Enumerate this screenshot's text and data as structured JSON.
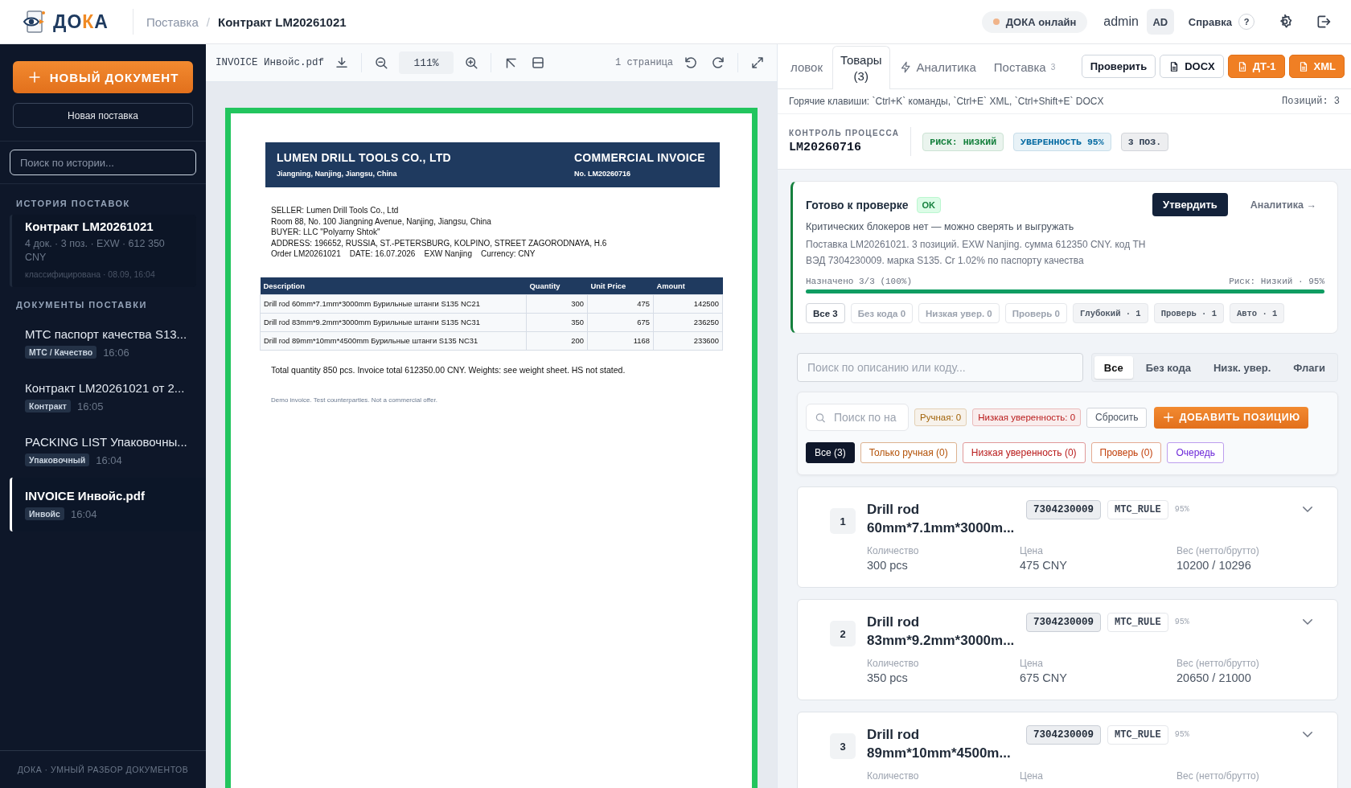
{
  "header": {
    "logo": [
      {
        "text": "ДО",
        "accent": false
      },
      {
        "text": "К",
        "accent": true
      },
      {
        "text": "А",
        "accent": false
      }
    ],
    "breadcrumb": {
      "items": [
        "Поставка",
        "Контракт LM20261021"
      ],
      "separator": "/"
    },
    "status": "ДОКА онлайн",
    "user": "admin",
    "avatar": "AD",
    "help": "Справка",
    "help_mark": "?"
  },
  "sidebar": {
    "new_button": "НОВЫЙ ДОКУМЕНТ",
    "new_shipment": "Новая поставка",
    "search_placeholder": "Поиск по истории...",
    "history_title": "ИСТОРИЯ ПОСТАВОК",
    "history": [
      {
        "title": "Контракт LM20261021",
        "meta": "4 док. · 3 поз. · EXW · 612 350 CNY",
        "status": "классифицирована · 08.09, 16:04",
        "selected": true
      }
    ],
    "documents_title": "ДОКУМЕНТЫ ПОСТАВКИ",
    "documents": [
      {
        "name": "MTC паспорт качества S13...",
        "tag": "MTC / Качество",
        "time": "16:06",
        "selected": false
      },
      {
        "name": "Контракт LM20261021 от 2...",
        "tag": "Контракт",
        "time": "16:05",
        "selected": false
      },
      {
        "name": "PACKING LIST Упаковочны...",
        "tag": "Упаковочный",
        "time": "16:04",
        "selected": false
      },
      {
        "name": "INVOICE Инвойс.pdf",
        "tag": "Инвойс",
        "time": "16:04",
        "selected": true
      }
    ],
    "footer": "ДОКА · УМНЫЙ РАЗБОР ДОКУМЕНТОВ"
  },
  "viewer": {
    "filename": "INVOICE Инвойс.pdf",
    "zoom": "111%",
    "pages": "1 страница",
    "document": {
      "company": "LUMEN DRILL TOOLS CO., LTD",
      "company_address": "Jiangning, Nanjing, Jiangsu, China",
      "title": "COMMERCIAL INVOICE",
      "number": "No. LM20260716",
      "lines": [
        "SELLER: Lumen Drill Tools Co., Ltd",
        "Room 88, No. 100 Jiangning Avenue, Nanjing, Jiangsu, China",
        "BUYER: LLC \"Polyarny Shtok\"",
        "ADDRESS: 196652, RUSSIA, ST.-PETERSBURG, KOLPINO, STREET ZAGORODNAYA, H.6",
        "Order LM20261021    DATE: 16.07.2026    EXW Nanjing    Currency: CNY"
      ],
      "columns": [
        "Description",
        "Quantity",
        "Unit Price",
        "Amount"
      ],
      "rows": [
        [
          "Drill rod 60mm*7.1mm*3000mm Бурильные штанги S135 NC21",
          "300",
          "475",
          "142500"
        ],
        [
          "Drill rod 83mm*9.2mm*3000mm Бурильные штанги S135 NC31",
          "350",
          "675",
          "236250"
        ],
        [
          "Drill rod 89mm*10mm*4500mm Бурильные штанги S135 NC31",
          "200",
          "1168",
          "233600"
        ]
      ],
      "total": "Total quantity 850 pcs. Invoice total 612350.00 CNY. Weights: see weight sheet. HS not stated.",
      "note": "Demo invoice. Test counterparties. Not a commercial offer."
    }
  },
  "panel": {
    "tabs": [
      {
        "label": "ловок",
        "kind": "plain",
        "selected": false
      },
      {
        "label": "Товары (3)",
        "kind": "plain",
        "selected": true
      },
      {
        "label": "Аналитика",
        "kind": "bolt",
        "selected": false
      },
      {
        "label": "Поставка",
        "kind": "count",
        "count": "3",
        "selected": false
      }
    ],
    "actions": [
      {
        "label": "Проверить",
        "kind": "outline"
      },
      {
        "label": "DOCX",
        "kind": "outline-doc"
      },
      {
        "label": "ДТ-1",
        "kind": "accent-report"
      },
      {
        "label": "XML",
        "kind": "accent-doc"
      }
    ],
    "hotkeys": "Горячие клавиши: `Ctrl+K` команды, `Ctrl+E` XML, `Ctrl+Shift+E` DOCX",
    "positions": "Позиций: 3",
    "process": {
      "label": "КОНТРОЛЬ ПРОЦЕССА",
      "id": "LM20260716",
      "badges": [
        {
          "text": "РИСК: НИЗКИЙ",
          "color": "#15803d"
        },
        {
          "text": "УВЕРЕННОСТЬ 95%",
          "color": "#0369a1"
        },
        {
          "text": "3 ПОЗ.",
          "color": "#334155"
        }
      ]
    },
    "status": {
      "title": "Готово к проверке",
      "badge": "OK",
      "approve": "Утвердить",
      "link": "Аналитика →",
      "summary": "Критических блокеров нет — можно сверять и выгружать",
      "details": "Поставка LM20261021. 3 позиций. EXW Nanjing. сумма 612350 CNY. код ТН ВЭД 7304230009. марка S135. Cr 1.02% по паспорту качества",
      "progress_label": "Назначено 3/3 (100%)",
      "progress_reading": "Риск: Низкий · 95%",
      "level": 1,
      "chips": [
        {
          "label": "Все 3",
          "kind": "filter",
          "selected": true
        },
        {
          "label": "Без кода 0",
          "kind": "filter",
          "selected": false
        },
        {
          "label": "Низкая увер. 0",
          "kind": "filter",
          "selected": false
        },
        {
          "label": "Проверь 0",
          "kind": "filter",
          "selected": false
        },
        {
          "label": "Глубокий · 1",
          "kind": "tier",
          "selected": false
        },
        {
          "label": "Проверь · 1",
          "kind": "tier",
          "selected": false
        },
        {
          "label": "Авто · 1",
          "kind": "tier",
          "selected": false
        }
      ]
    },
    "search_placeholder": "Поиск по описанию или коду...",
    "segments": [
      {
        "label": "Все",
        "selected": true
      },
      {
        "label": "Без кода",
        "selected": false
      },
      {
        "label": "Низк. увер.",
        "selected": false
      },
      {
        "label": "Флаги",
        "selected": false
      }
    ],
    "filter_search_placeholder": "Поиск по на",
    "counters": [
      {
        "text": "Ручная: 0",
        "color": "#a16207"
      },
      {
        "text": "Низкая уверенность: 0",
        "color": "#b91c1c"
      }
    ],
    "reset": "Сбросить",
    "add": "ДОБАВИТЬ ПОЗИЦИЮ",
    "filters": [
      {
        "label": "Все (3)",
        "color": "#0f172a",
        "selected": true
      },
      {
        "label": "Только ручная (0)",
        "color": "#b45309",
        "selected": false
      },
      {
        "label": "Низкая уверенность (0)",
        "color": "#b91c1c",
        "selected": false
      },
      {
        "label": "Проверь (0)",
        "color": "#c2410c",
        "selected": false
      },
      {
        "label": "Очередь",
        "color": "#6d28d9",
        "selected": false
      }
    ],
    "items": [
      {
        "number": "1",
        "name": "Drill rod 60mm*7.1mm*3000m...",
        "code": "7304230009",
        "rule": "MTC_RULE",
        "confidence": "95%",
        "fields": [
          {
            "label": "Количество",
            "value": "300 pcs"
          },
          {
            "label": "Цена",
            "value": "475 CNY"
          },
          {
            "label": "Вес (нетто/брутто)",
            "value": "10200 / 10296"
          }
        ]
      },
      {
        "number": "2",
        "name": "Drill rod 83mm*9.2mm*3000m...",
        "code": "7304230009",
        "rule": "MTC_RULE",
        "confidence": "95%",
        "fields": [
          {
            "label": "Количество",
            "value": "350 pcs"
          },
          {
            "label": "Цена",
            "value": "675 CNY"
          },
          {
            "label": "Вес (нетто/брутто)",
            "value": "20650 / 21000"
          }
        ]
      },
      {
        "number": "3",
        "name": "Drill rod 89mm*10mm*4500m...",
        "code": "7304230009",
        "rule": "MTC_RULE",
        "confidence": "95%",
        "fields": [
          {
            "label": "Количество"
          },
          {
            "label": "Цена"
          },
          {
            "label": "Вес (нетто/брутто)"
          }
        ]
      }
    ]
  }
}
